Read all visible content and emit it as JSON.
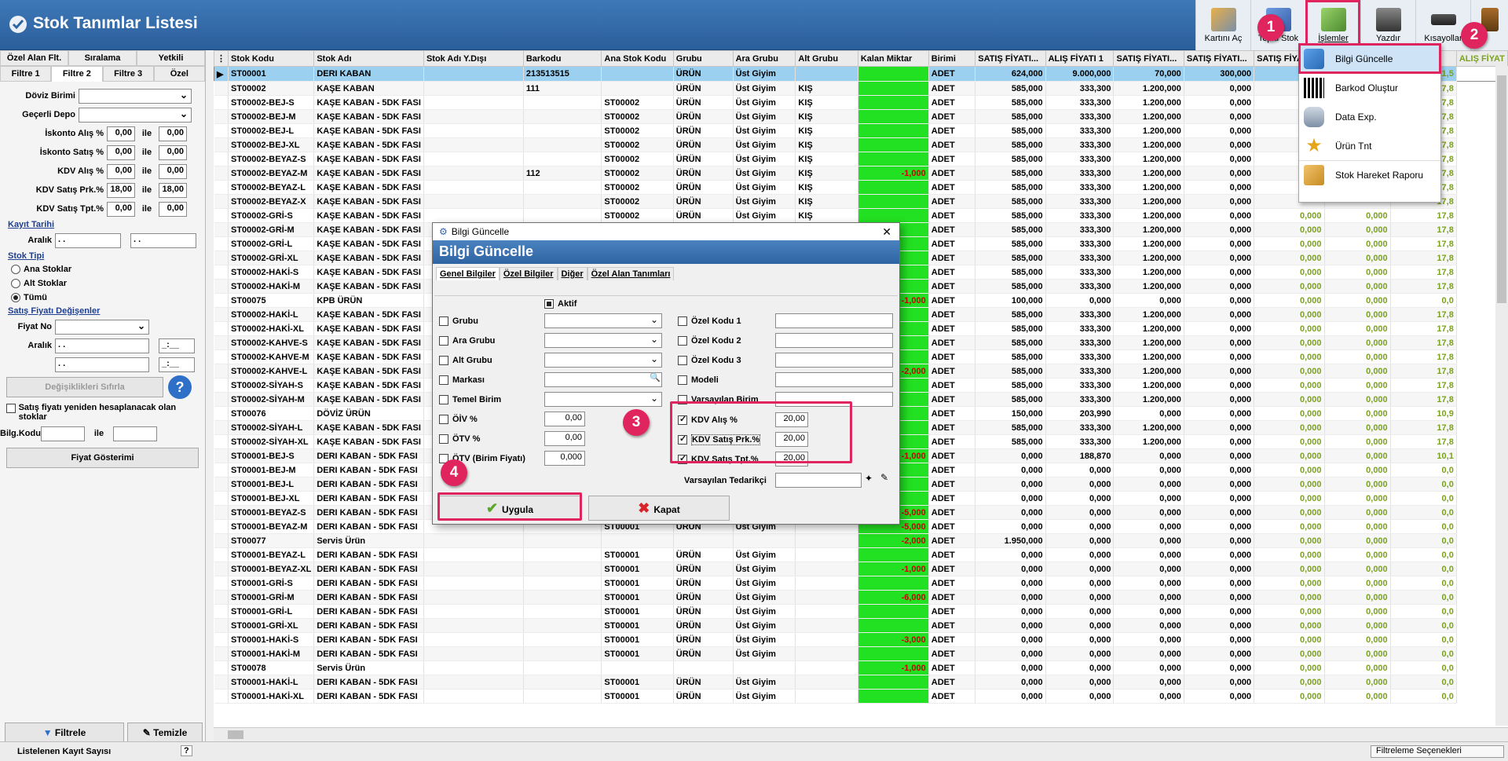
{
  "window": {
    "title": "Stok Tanımlar Listesi"
  },
  "toolbar": [
    {
      "label": "Kartını Aç",
      "icon": "open-card-icon"
    },
    {
      "label": "Toplu Stok",
      "icon": "bulk-stock-icon"
    },
    {
      "label": "İşlemler",
      "icon": "operations-icon"
    },
    {
      "label": "Yazdır",
      "icon": "printer-icon"
    },
    {
      "label": "Kısayollar",
      "icon": "shortcuts-icon"
    },
    {
      "label": "",
      "icon": "exit-icon"
    }
  ],
  "left": {
    "tabs_top": [
      "Özel Alan Flt.",
      "Sıralama",
      "Yetkili"
    ],
    "tabs_bottom": [
      "Filtre 1",
      "Filtre 2",
      "Filtre 3",
      "Özel"
    ],
    "doviz_label": "Döviz Birimi",
    "depo_label": "Geçerli Depo",
    "ranges": [
      {
        "label": "İskonto Alış %",
        "a": "0,00",
        "b": "0,00"
      },
      {
        "label": "İskonto Satış %",
        "a": "0,00",
        "b": "0,00"
      },
      {
        "label": "KDV Alış %",
        "a": "0,00",
        "b": "0,00"
      },
      {
        "label": "KDV Satış Prk.%",
        "a": "18,00",
        "b": "18,00"
      },
      {
        "label": "KDV Satış Tpt.%",
        "a": "0,00",
        "b": "0,00"
      }
    ],
    "ile": "ile",
    "kayit_tarihi": "Kayıt Tarihi",
    "aralik": "Aralık",
    "date_blank": " .  .",
    "stok_tipi": "Stok Tipi",
    "radios": [
      "Ana Stoklar",
      "Alt Stoklar",
      "Tümü"
    ],
    "satis_fiyati": "Satış Fiyatı Değişenler",
    "fiyat_no": "Fiyat No",
    "time_blank": "  _:__",
    "reset_btn": "Değişiklikleri Sıfırla",
    "recalc": "Satış fiyatı yeniden hesaplanacak olan stoklar",
    "bilg_kodu": "Bilg.Kodu",
    "fiyat_gosterimi": "Fiyat Gösterimi",
    "filtrele": "Filtrele",
    "temizle": "Temizle"
  },
  "grid": {
    "columns": [
      "Stok Kodu",
      "Stok Adı",
      "Stok Adı Y.Dışı",
      "Barkodu",
      "Ana Stok Kodu",
      "Grubu",
      "Ara Grubu",
      "Alt Grubu",
      "Kalan Miktar",
      "Birimi",
      "SATIŞ FİYATI...",
      "ALIŞ FİYATI 1",
      "SATIŞ FİYATI...",
      "SATIŞ FİYATI...",
      "SATIŞ FİYATI...",
      "",
      "",
      "ALIŞ FİYAT"
    ],
    "rows": [
      [
        "ST00001",
        "DERI KABAN",
        "",
        "213513515",
        "",
        "ÜRÜN",
        "Üst Giyim",
        "",
        "",
        "ADET",
        "624,000",
        "9.000,000",
        "70,000",
        "300,000",
        "",
        "",
        "481,5"
      ],
      [
        "ST00002",
        "KAŞE KABAN",
        "",
        "111",
        "",
        "ÜRÜN",
        "Üst Giyim",
        "KIŞ",
        "",
        "ADET",
        "585,000",
        "333,300",
        "1.200,000",
        "0,000",
        "",
        "",
        "17,8"
      ],
      [
        "ST00002-BEJ-S",
        "KAŞE KABAN - 5DK FASI",
        "",
        "",
        "ST00002",
        "ÜRÜN",
        "Üst Giyim",
        "KIŞ",
        "",
        "ADET",
        "585,000",
        "333,300",
        "1.200,000",
        "0,000",
        "",
        "",
        "17,8"
      ],
      [
        "ST00002-BEJ-M",
        "KAŞE KABAN - 5DK FASI",
        "",
        "",
        "ST00002",
        "ÜRÜN",
        "Üst Giyim",
        "KIŞ",
        "",
        "ADET",
        "585,000",
        "333,300",
        "1.200,000",
        "0,000",
        "",
        "",
        "17,8"
      ],
      [
        "ST00002-BEJ-L",
        "KAŞE KABAN - 5DK FASI",
        "",
        "",
        "ST00002",
        "ÜRÜN",
        "Üst Giyim",
        "KIŞ",
        "",
        "ADET",
        "585,000",
        "333,300",
        "1.200,000",
        "0,000",
        "",
        "",
        "17,8"
      ],
      [
        "ST00002-BEJ-XL",
        "KAŞE KABAN - 5DK FASI",
        "",
        "",
        "ST00002",
        "ÜRÜN",
        "Üst Giyim",
        "KIŞ",
        "",
        "ADET",
        "585,000",
        "333,300",
        "1.200,000",
        "0,000",
        "",
        "",
        "17,8"
      ],
      [
        "ST00002-BEYAZ-S",
        "KAŞE KABAN - 5DK FASI",
        "",
        "",
        "ST00002",
        "ÜRÜN",
        "Üst Giyim",
        "KIŞ",
        "",
        "ADET",
        "585,000",
        "333,300",
        "1.200,000",
        "0,000",
        "",
        "",
        "17,8"
      ],
      [
        "ST00002-BEYAZ-M",
        "KAŞE KABAN - 5DK FASI",
        "",
        "112",
        "ST00002",
        "ÜRÜN",
        "Üst Giyim",
        "KIŞ",
        "-1,000",
        "ADET",
        "585,000",
        "333,300",
        "1.200,000",
        "0,000",
        "",
        "",
        "17,8"
      ],
      [
        "ST00002-BEYAZ-L",
        "KAŞE KABAN - 5DK FASI",
        "",
        "",
        "ST00002",
        "ÜRÜN",
        "Üst Giyim",
        "KIŞ",
        "",
        "ADET",
        "585,000",
        "333,300",
        "1.200,000",
        "0,000",
        "",
        "",
        "17,8"
      ],
      [
        "ST00002-BEYAZ-X",
        "KAŞE KABAN - 5DK FASI",
        "",
        "",
        "ST00002",
        "ÜRÜN",
        "Üst Giyim",
        "KIŞ",
        "",
        "ADET",
        "585,000",
        "333,300",
        "1.200,000",
        "0,000",
        "",
        "",
        "17,8"
      ],
      [
        "ST00002-GRİ-S",
        "KAŞE KABAN - 5DK FASI",
        "",
        "",
        "ST00002",
        "ÜRÜN",
        "Üst Giyim",
        "KIŞ",
        "",
        "ADET",
        "585,000",
        "333,300",
        "1.200,000",
        "0,000",
        "0,000",
        "0,000",
        "17,8"
      ],
      [
        "ST00002-GRİ-M",
        "KAŞE KABAN - 5DK FASI",
        "",
        "",
        "",
        "",
        "",
        "",
        "",
        "ADET",
        "585,000",
        "333,300",
        "1.200,000",
        "0,000",
        "0,000",
        "0,000",
        "17,8"
      ],
      [
        "ST00002-GRİ-L",
        "KAŞE KABAN - 5DK FASI",
        "",
        "",
        "",
        "",
        "",
        "",
        "",
        "ADET",
        "585,000",
        "333,300",
        "1.200,000",
        "0,000",
        "0,000",
        "0,000",
        "17,8"
      ],
      [
        "ST00002-GRİ-XL",
        "KAŞE KABAN - 5DK FASI",
        "",
        "",
        "",
        "",
        "",
        "",
        "",
        "ADET",
        "585,000",
        "333,300",
        "1.200,000",
        "0,000",
        "0,000",
        "0,000",
        "17,8"
      ],
      [
        "ST00002-HAKİ-S",
        "KAŞE KABAN - 5DK FASI",
        "",
        "",
        "",
        "",
        "",
        "",
        "",
        "ADET",
        "585,000",
        "333,300",
        "1.200,000",
        "0,000",
        "0,000",
        "0,000",
        "17,8"
      ],
      [
        "ST00002-HAKİ-M",
        "KAŞE KABAN - 5DK FASI",
        "",
        "",
        "",
        "",
        "",
        "",
        "",
        "ADET",
        "585,000",
        "333,300",
        "1.200,000",
        "0,000",
        "0,000",
        "0,000",
        "17,8"
      ],
      [
        "ST00075",
        "KPB ÜRÜN",
        "",
        "",
        "",
        "",
        "",
        "",
        "-1,000",
        "ADET",
        "100,000",
        "0,000",
        "0,000",
        "0,000",
        "0,000",
        "0,000",
        "0,0"
      ],
      [
        "ST00002-HAKİ-L",
        "KAŞE KABAN - 5DK FASI",
        "",
        "",
        "",
        "",
        "",
        "",
        "",
        "ADET",
        "585,000",
        "333,300",
        "1.200,000",
        "0,000",
        "0,000",
        "0,000",
        "17,8"
      ],
      [
        "ST00002-HAKİ-XL",
        "KAŞE KABAN - 5DK FASI",
        "",
        "",
        "",
        "",
        "",
        "",
        "",
        "ADET",
        "585,000",
        "333,300",
        "1.200,000",
        "0,000",
        "0,000",
        "0,000",
        "17,8"
      ],
      [
        "ST00002-KAHVE-S",
        "KAŞE KABAN - 5DK FASI",
        "",
        "",
        "",
        "",
        "",
        "",
        "",
        "ADET",
        "585,000",
        "333,300",
        "1.200,000",
        "0,000",
        "0,000",
        "0,000",
        "17,8"
      ],
      [
        "ST00002-KAHVE-M",
        "KAŞE KABAN - 5DK FASI",
        "",
        "",
        "",
        "",
        "",
        "",
        "",
        "ADET",
        "585,000",
        "333,300",
        "1.200,000",
        "0,000",
        "0,000",
        "0,000",
        "17,8"
      ],
      [
        "ST00002-KAHVE-L",
        "KAŞE KABAN - 5DK FASI",
        "",
        "",
        "",
        "",
        "",
        "",
        "-2,000",
        "ADET",
        "585,000",
        "333,300",
        "1.200,000",
        "0,000",
        "0,000",
        "0,000",
        "17,8"
      ],
      [
        "ST00002-SİYAH-S",
        "KAŞE KABAN - 5DK FASI",
        "",
        "",
        "",
        "",
        "",
        "",
        "",
        "ADET",
        "585,000",
        "333,300",
        "1.200,000",
        "0,000",
        "0,000",
        "0,000",
        "17,8"
      ],
      [
        "ST00002-SİYAH-M",
        "KAŞE KABAN - 5DK FASI",
        "",
        "",
        "",
        "",
        "",
        "",
        "",
        "ADET",
        "585,000",
        "333,300",
        "1.200,000",
        "0,000",
        "0,000",
        "0,000",
        "17,8"
      ],
      [
        "ST00076",
        "DÖVİZ ÜRÜN",
        "",
        "",
        "",
        "",
        "",
        "",
        "",
        "ADET",
        "150,000",
        "203,990",
        "0,000",
        "0,000",
        "0,000",
        "0,000",
        "10,9"
      ],
      [
        "ST00002-SİYAH-L",
        "KAŞE KABAN - 5DK FASI",
        "",
        "",
        "",
        "",
        "",
        "",
        "",
        "ADET",
        "585,000",
        "333,300",
        "1.200,000",
        "0,000",
        "0,000",
        "0,000",
        "17,8"
      ],
      [
        "ST00002-SİYAH-XL",
        "KAŞE KABAN - 5DK FASI",
        "",
        "",
        "",
        "",
        "",
        "",
        "",
        "ADET",
        "585,000",
        "333,300",
        "1.200,000",
        "0,000",
        "0,000",
        "0,000",
        "17,8"
      ],
      [
        "ST00001-BEJ-S",
        "DERI KABAN - 5DK FASI",
        "",
        "",
        "",
        "",
        "",
        "",
        "-1,000",
        "ADET",
        "0,000",
        "188,870",
        "0,000",
        "0,000",
        "0,000",
        "0,000",
        "10,1"
      ],
      [
        "ST00001-BEJ-M",
        "DERI KABAN - 5DK FASI",
        "",
        "",
        "",
        "",
        "",
        "",
        "",
        "ADET",
        "0,000",
        "0,000",
        "0,000",
        "0,000",
        "0,000",
        "0,000",
        "0,0"
      ],
      [
        "ST00001-BEJ-L",
        "DERI KABAN - 5DK FASI",
        "",
        "",
        "",
        "",
        "",
        "",
        "",
        "ADET",
        "0,000",
        "0,000",
        "0,000",
        "0,000",
        "0,000",
        "0,000",
        "0,0"
      ],
      [
        "ST00001-BEJ-XL",
        "DERI KABAN - 5DK FASI",
        "",
        "",
        "",
        "",
        "",
        "",
        "",
        "ADET",
        "0,000",
        "0,000",
        "0,000",
        "0,000",
        "0,000",
        "0,000",
        "0,0"
      ],
      [
        "ST00001-BEYAZ-S",
        "DERI KABAN - 5DK FASI",
        "",
        "",
        "ST00001",
        "ÜRÜN",
        "Üst Giyim",
        "",
        "-5,000",
        "ADET",
        "0,000",
        "0,000",
        "0,000",
        "0,000",
        "0,000",
        "0,000",
        "0,0"
      ],
      [
        "ST00001-BEYAZ-M",
        "DERI KABAN - 5DK FASI",
        "",
        "",
        "ST00001",
        "ÜRÜN",
        "Üst Giyim",
        "",
        "-5,000",
        "ADET",
        "0,000",
        "0,000",
        "0,000",
        "0,000",
        "0,000",
        "0,000",
        "0,0"
      ],
      [
        "ST00077",
        "Servis Ürün",
        "",
        "",
        "",
        "",
        "",
        "",
        "-2,000",
        "ADET",
        "1.950,000",
        "0,000",
        "0,000",
        "0,000",
        "0,000",
        "0,000",
        "0,0"
      ],
      [
        "ST00001-BEYAZ-L",
        "DERI KABAN - 5DK FASI",
        "",
        "",
        "ST00001",
        "ÜRÜN",
        "Üst Giyim",
        "",
        "",
        "ADET",
        "0,000",
        "0,000",
        "0,000",
        "0,000",
        "0,000",
        "0,000",
        "0,0"
      ],
      [
        "ST00001-BEYAZ-XL",
        "DERI KABAN - 5DK FASI",
        "",
        "",
        "ST00001",
        "ÜRÜN",
        "Üst Giyim",
        "",
        "-1,000",
        "ADET",
        "0,000",
        "0,000",
        "0,000",
        "0,000",
        "0,000",
        "0,000",
        "0,0"
      ],
      [
        "ST00001-GRİ-S",
        "DERI KABAN - 5DK FASI",
        "",
        "",
        "ST00001",
        "ÜRÜN",
        "Üst Giyim",
        "",
        "",
        "ADET",
        "0,000",
        "0,000",
        "0,000",
        "0,000",
        "0,000",
        "0,000",
        "0,0"
      ],
      [
        "ST00001-GRİ-M",
        "DERI KABAN - 5DK FASI",
        "",
        "",
        "ST00001",
        "ÜRÜN",
        "Üst Giyim",
        "",
        "-6,000",
        "ADET",
        "0,000",
        "0,000",
        "0,000",
        "0,000",
        "0,000",
        "0,000",
        "0,0"
      ],
      [
        "ST00001-GRİ-L",
        "DERI KABAN - 5DK FASI",
        "",
        "",
        "ST00001",
        "ÜRÜN",
        "Üst Giyim",
        "",
        "",
        "ADET",
        "0,000",
        "0,000",
        "0,000",
        "0,000",
        "0,000",
        "0,000",
        "0,0"
      ],
      [
        "ST00001-GRİ-XL",
        "DERI KABAN - 5DK FASI",
        "",
        "",
        "ST00001",
        "ÜRÜN",
        "Üst Giyim",
        "",
        "",
        "ADET",
        "0,000",
        "0,000",
        "0,000",
        "0,000",
        "0,000",
        "0,000",
        "0,0"
      ],
      [
        "ST00001-HAKİ-S",
        "DERI KABAN - 5DK FASI",
        "",
        "",
        "ST00001",
        "ÜRÜN",
        "Üst Giyim",
        "",
        "-3,000",
        "ADET",
        "0,000",
        "0,000",
        "0,000",
        "0,000",
        "0,000",
        "0,000",
        "0,0"
      ],
      [
        "ST00001-HAKİ-M",
        "DERI KABAN - 5DK FASI",
        "",
        "",
        "ST00001",
        "ÜRÜN",
        "Üst Giyim",
        "",
        "",
        "ADET",
        "0,000",
        "0,000",
        "0,000",
        "0,000",
        "0,000",
        "0,000",
        "0,0"
      ],
      [
        "ST00078",
        "Servis Ürün",
        "",
        "",
        "",
        "",
        "",
        "",
        "-1,000",
        "ADET",
        "0,000",
        "0,000",
        "0,000",
        "0,000",
        "0,000",
        "0,000",
        "0,0"
      ],
      [
        "ST00001-HAKİ-L",
        "DERI KABAN - 5DK FASI",
        "",
        "",
        "ST00001",
        "ÜRÜN",
        "Üst Giyim",
        "",
        "",
        "ADET",
        "0,000",
        "0,000",
        "0,000",
        "0,000",
        "0,000",
        "0,000",
        "0,0"
      ],
      [
        "ST00001-HAKİ-XL",
        "DERI KABAN - 5DK FASI",
        "",
        "",
        "ST00001",
        "ÜRÜN",
        "Üst Giyim",
        "",
        "",
        "ADET",
        "0,000",
        "0,000",
        "0,000",
        "0,000",
        "0,000",
        "0,000",
        "0,0"
      ]
    ]
  },
  "menu": [
    {
      "label": "Bilgi Güncelle",
      "icon": "update-info-icon"
    },
    {
      "label": "Barkod Oluştur",
      "icon": "qr-code-icon"
    },
    {
      "label": "Data Exp.",
      "icon": "database-export-icon"
    },
    {
      "label": "Ürün Tnt",
      "icon": "product-stars-icon"
    },
    {
      "label": "Stok Hareket Raporu",
      "icon": "stock-report-icon"
    }
  ],
  "dialog": {
    "title": "Bilgi Güncelle",
    "header": "Bilgi Güncelle",
    "tabs": [
      "Genel Bilgiler",
      "Özel Bilgiler",
      "Diğer",
      "Özel Alan Tanımları"
    ],
    "aktif": "Aktif",
    "left_fields": [
      "Grubu",
      "Ara Grubu",
      "Alt Grubu",
      "Markası",
      "Temel Birim"
    ],
    "tax_fields": [
      {
        "label": "ÖİV %",
        "value": "0,00"
      },
      {
        "label": "ÖTV %",
        "value": "0,00"
      },
      {
        "label": "ÖTV (Birim Fiyatı)",
        "value": "0,000"
      }
    ],
    "right_fields": [
      "Özel Kodu 1",
      "Özel Kodu 2",
      "Özel Kodu 3",
      "Modeli",
      "Varsayılan Birim"
    ],
    "kdv_fields": [
      {
        "label": "KDV Alış %",
        "value": "20,00"
      },
      {
        "label": "KDV Satış Prk.%",
        "value": "20,00"
      },
      {
        "label": "KDV Satış Tpt.%",
        "value": "20,00"
      }
    ],
    "tedarikci": "Varsayılan Tedarikçi",
    "apply": "Uygula",
    "close": "Kapat"
  },
  "badges": [
    "1",
    "2",
    "3",
    "4"
  ],
  "status": {
    "count_label": "Listelenen Kayıt Sayısı",
    "q": "?",
    "filter_options": "Filtreleme Seçenekleri"
  },
  "colors": {
    "title_bar": "#2f64a2",
    "highlight": "#e0245e",
    "green_cell": "#22e022",
    "selected_row": "#9cd0f0"
  }
}
